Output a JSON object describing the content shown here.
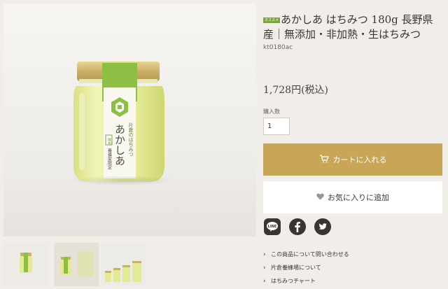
{
  "product": {
    "badge": "オススメ",
    "title": "あかしあ はちみつ 180g 長野県産｜無添加・非加熱・生はちみつ",
    "sku": "kt0180ac",
    "price": "1,728円(税込)",
    "quantity_label": "購入数",
    "quantity_value": "1",
    "add_to_cart": "カートに入れる",
    "add_to_favorites": "お気に入りに追加"
  },
  "jar_label": {
    "brand_small": "片倉のはちみつ",
    "name": "あかしあ",
    "seal": "信州",
    "sub": "養蜂家限定"
  },
  "social": [
    "line-icon",
    "facebook-icon",
    "twitter-icon"
  ],
  "links": [
    {
      "label": "この商品について問い合わせる"
    },
    {
      "label": "片倉養蜂場について"
    },
    {
      "label": "はちみつチャート"
    }
  ],
  "colors": {
    "background": "#f1eee9",
    "accent_gold": "#c7a657",
    "label_green": "#8ebf45",
    "honey": "#e6ec9a",
    "text": "#3a3530"
  }
}
